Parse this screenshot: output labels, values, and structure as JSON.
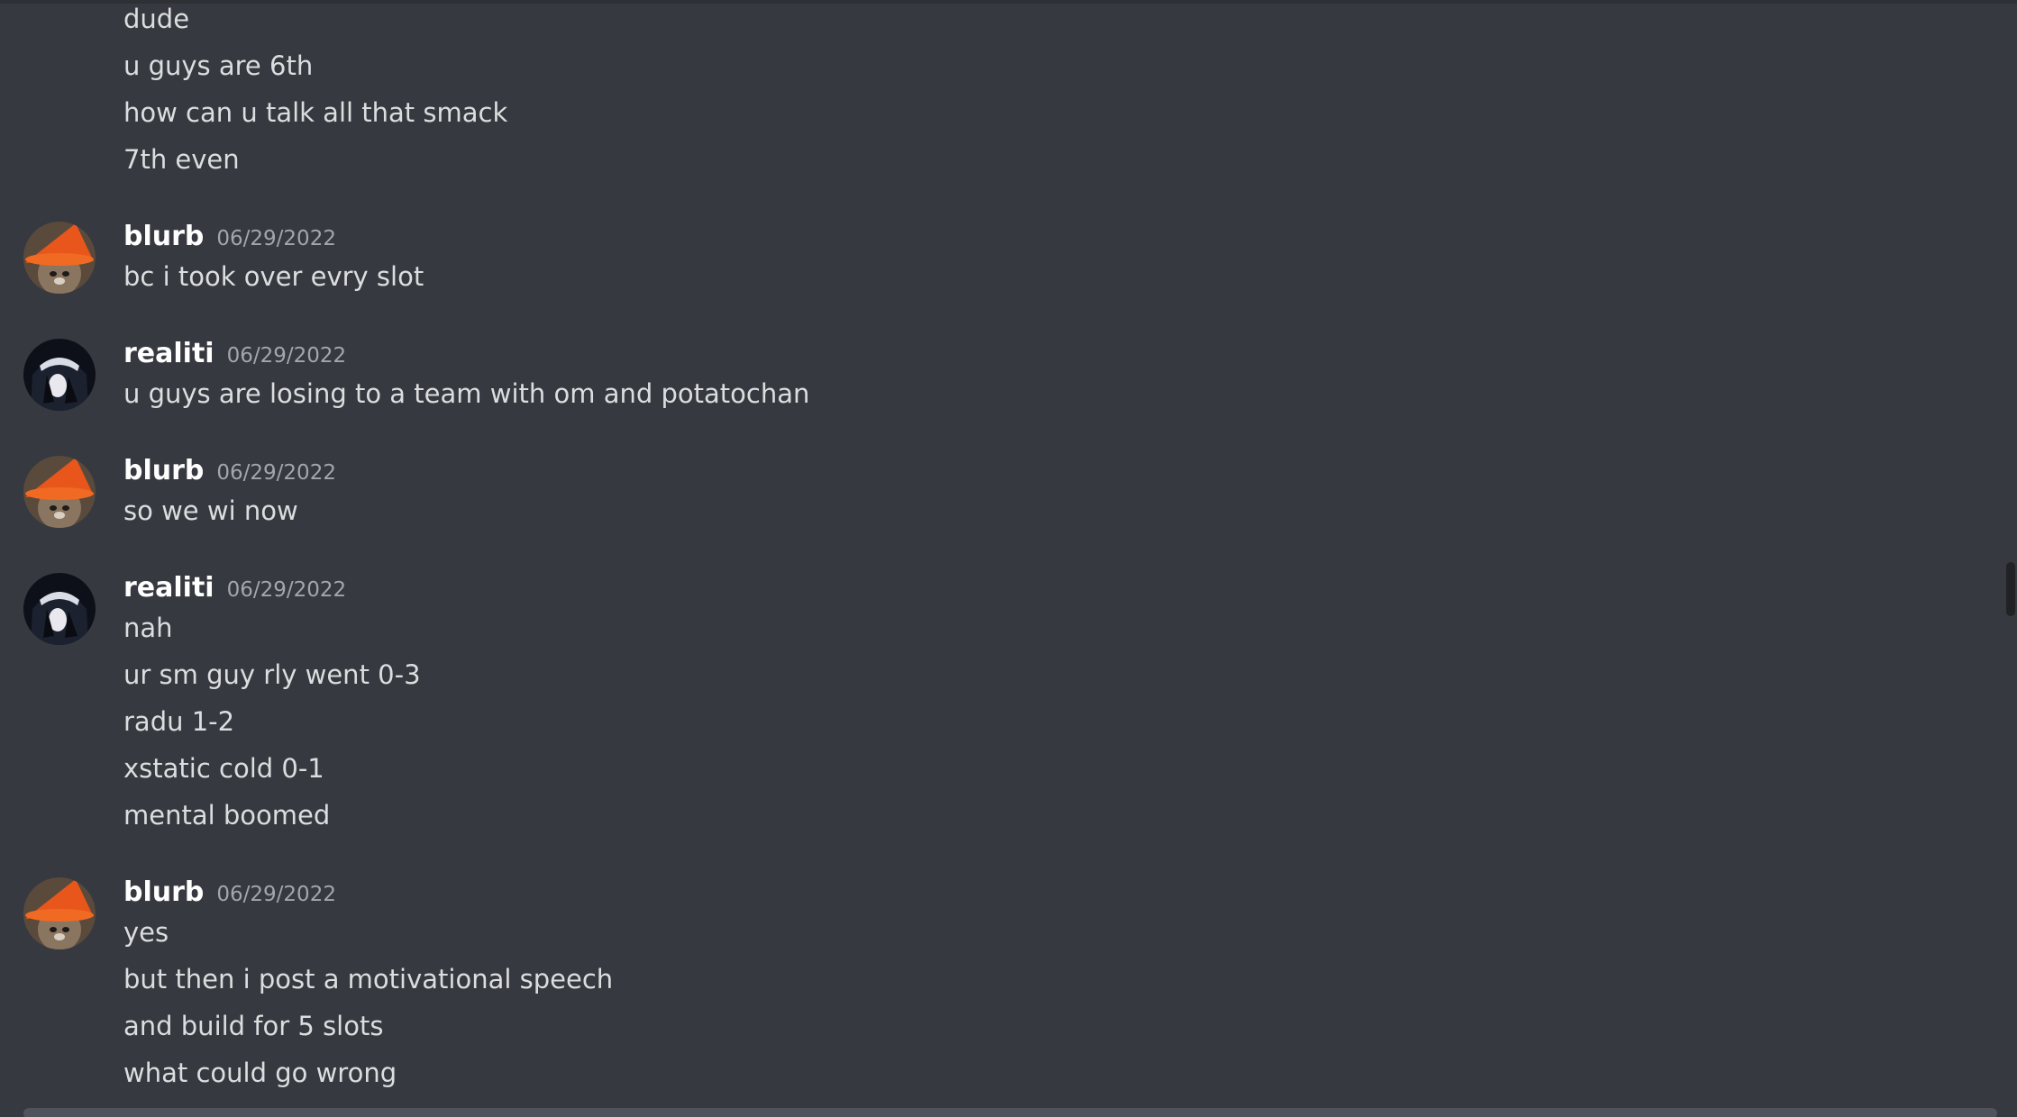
{
  "messages": [
    {
      "author": "",
      "date": "",
      "avatar": "",
      "lines": [
        "dude",
        "u guys are 6th",
        "how can u talk all that smack",
        "7th even"
      ]
    },
    {
      "author": "blurb",
      "date": "06/29/2022",
      "avatar": "orange-hat-cat",
      "lines": [
        "bc i took over evry slot"
      ]
    },
    {
      "author": "realiti",
      "date": "06/29/2022",
      "avatar": "dark-anime-character",
      "lines": [
        "u guys are losing to a team with om and potatochan"
      ]
    },
    {
      "author": "blurb",
      "date": "06/29/2022",
      "avatar": "orange-hat-cat",
      "lines": [
        "so we wi now"
      ]
    },
    {
      "author": "realiti",
      "date": "06/29/2022",
      "avatar": "dark-anime-character",
      "lines": [
        "nah",
        "ur sm guy rly went 0-3",
        "radu 1-2",
        "xstatic cold 0-1",
        "mental boomed"
      ]
    },
    {
      "author": "blurb",
      "date": "06/29/2022",
      "avatar": "orange-hat-cat",
      "lines": [
        "yes",
        "but then i post a motivational speech",
        "and build for 5 slots",
        "what could go wrong"
      ]
    }
  ],
  "colors": {
    "background": "#36393f",
    "username": "#ffffff",
    "message_text": "#dcddde",
    "timestamp": "#a3a6aa"
  }
}
